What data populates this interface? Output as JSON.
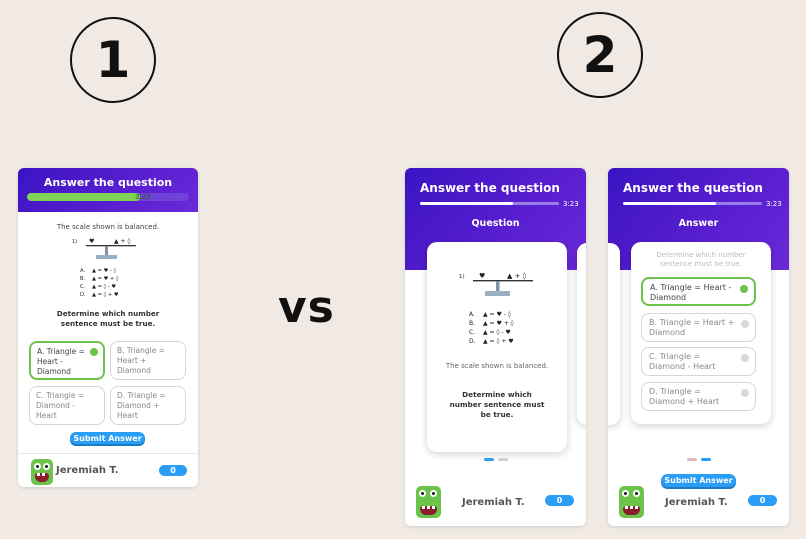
{
  "labels": {
    "one": "1",
    "two": "2",
    "vs": "vs"
  },
  "header": {
    "title": "Answer the question",
    "timer": "3:23"
  },
  "section": {
    "question": "Question",
    "answer": "Answer"
  },
  "question": {
    "premise": "The scale shown is balanced.",
    "prompt": "Determine which number sentence must be true.",
    "figure_number": "1)",
    "figure_rows": [
      {
        "letter": "A.",
        "eq": "▲ = ♥ - ◊"
      },
      {
        "letter": "B.",
        "eq": "▲ = ♥ + ◊"
      },
      {
        "letter": "C.",
        "eq": "▲ = ◊ - ♥"
      },
      {
        "letter": "D.",
        "eq": "▲ = ◊ + ♥"
      }
    ],
    "scale_left": "♥",
    "scale_right": "▲ + ◊"
  },
  "options_v1": [
    {
      "text": "A. Triangle = Heart - Diamond"
    },
    {
      "text": "B. Triangle = Heart + Diamond"
    },
    {
      "text": "C. Triangle = Diamond - Heart"
    },
    {
      "text": "D. Triangle = Diamond + Heart"
    }
  ],
  "options_v2": [
    {
      "text": "A. Triangle = Heart - Diamond"
    },
    {
      "text": "B. Triangle = Heart + Diamond"
    },
    {
      "text": "C. Triangle = Diamond - Heart"
    },
    {
      "text": "D. Triangle = Diamond + Heart"
    }
  ],
  "submit_label": "Submit Answer",
  "player": {
    "name": "Jeremiah T.",
    "score": "0"
  },
  "progress": {
    "v1": 0.7,
    "v2": 0.67
  },
  "colors": {
    "header": "#4a18c9",
    "accent_green": "#6cc34a",
    "accent_blue": "#2a9df4"
  },
  "icons": {
    "avatar": "monster-avatar-icon"
  }
}
